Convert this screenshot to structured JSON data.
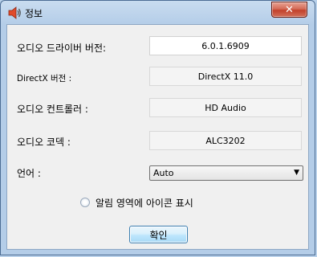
{
  "window": {
    "title": "정보",
    "close_symbol": "✕",
    "title_icon": "speaker-icon"
  },
  "rows": [
    {
      "label": "오디오 드라이버 버전:",
      "value": "6.0.1.6909"
    },
    {
      "label": "DirectX 버전 :",
      "value": "DirectX 11.0"
    },
    {
      "label": "오디오 컨트롤러 :",
      "value": "HD Audio"
    },
    {
      "label": "오디오 코덱 :",
      "value": "ALC3202"
    }
  ],
  "language": {
    "label": "언어 :",
    "selected": "Auto"
  },
  "tray_option": {
    "label": "알림 영역에 아이콘 표시",
    "checked": false
  },
  "buttons": {
    "ok_label": "확인"
  },
  "colors": {
    "close_button": "#c2412b",
    "ok_button_border": "#3c7fb1"
  }
}
